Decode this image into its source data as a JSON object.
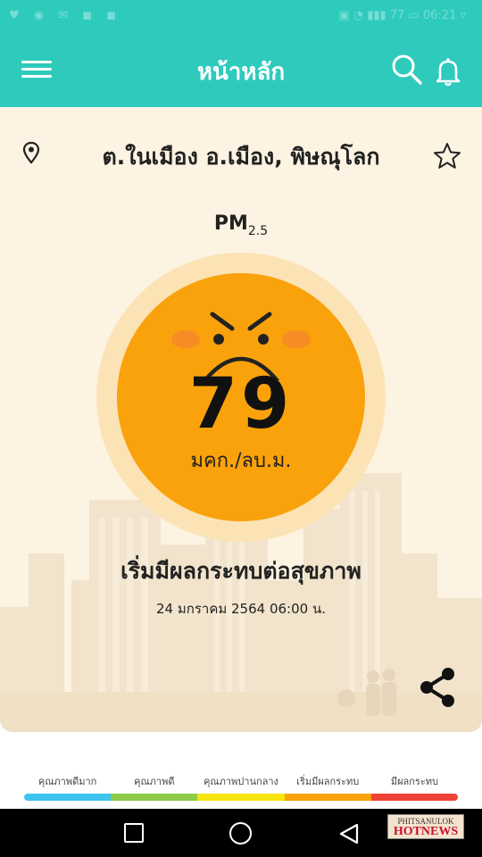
{
  "status_bar": {
    "left_icons": "♥ ◉ ✉ ◼ ◼",
    "right_text": "▣ ◔ ▮▮▮ 77 ▭ 06:21 ▿"
  },
  "app_bar": {
    "title": "หน้าหลัก",
    "icons": [
      "menu-icon",
      "search-icon",
      "bell-icon"
    ]
  },
  "location": {
    "name": "ต.ในเมือง อ.เมือง, พิษณุโลก"
  },
  "pm": {
    "label": "PM",
    "subscript": "2.5"
  },
  "reading": {
    "value": "79",
    "unit": "มคก./ลบ.ม.",
    "status": "เริ่มมีผลกระทบต่อสุขภาพ",
    "timestamp": "24 มกราคม 2564   06:00 น.",
    "dial_color": "#f9a20b"
  },
  "legend": [
    {
      "label": "คุณภาพดีมาก",
      "color": "#3cc3ee"
    },
    {
      "label": "คุณภาพดี",
      "color": "#8ccc4a"
    },
    {
      "label": "คุณภาพปานกลาง",
      "color": "#f6e40e"
    },
    {
      "label": "เริ่มมีผลกระทบ",
      "color": "#f9a20b"
    },
    {
      "label": "มีผลกระทบ",
      "color": "#ef4136"
    }
  ],
  "colors": {
    "primary": "#2ecbbd",
    "card_bg": "#fdf3e2"
  },
  "watermark": {
    "line1": "PHITSANULOK",
    "line2": "HOTNEWS"
  }
}
